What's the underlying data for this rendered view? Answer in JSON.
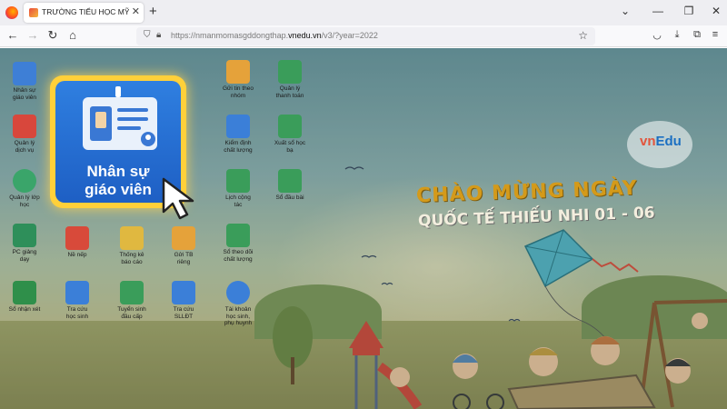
{
  "browser": {
    "tab_title": "TRƯỜNG TIỂU HỌC MỸ AN HƯ",
    "url_prefix": "https://nmanmomasgddongthap.",
    "url_domain": "vnedu.vn",
    "url_suffix": "/v3/?year=2022"
  },
  "callout": {
    "label_line1": "Nhân sự",
    "label_line2": "giáo viên"
  },
  "desktop_icons": [
    {
      "label": "Nhân sự\ngiáo viên"
    },
    {
      "label": "Gửi tin theo\nnhóm"
    },
    {
      "label": "Quản lý\nthanh toán"
    },
    {
      "label": "Quản lý\ndịch vụ"
    },
    {
      "label": "Kiểm định\nchất lượng"
    },
    {
      "label": "Xuất sổ học\nbạ"
    },
    {
      "label": "Quản lý lớp\nhọc"
    },
    {
      "label": "Lịch cộng\ntác"
    },
    {
      "label": "Sổ đầu bài"
    },
    {
      "label": "PC giảng\ndạy"
    },
    {
      "label": "Nề nếp"
    },
    {
      "label": "Thống kê\nbáo cáo"
    },
    {
      "label": "Gửi TB\nriêng"
    },
    {
      "label": "Sổ theo dõi\nchất lượng"
    },
    {
      "label": "Sổ nhận xét"
    },
    {
      "label": "Tra cứu\nhọc sinh"
    },
    {
      "label": "Tuyển sinh\nđầu cấp"
    },
    {
      "label": "Tra cứu\nSLLĐT"
    },
    {
      "label": "Tài khoản\nhọc sinh,\nphụ huynh"
    }
  ],
  "banner": {
    "line1": "CHÀO MỪNG NGÀY",
    "line2": "QUỐC TẾ THIẾU NHI 01 - 06"
  },
  "logo": {
    "part1": "vn",
    "part2": "Edu"
  }
}
